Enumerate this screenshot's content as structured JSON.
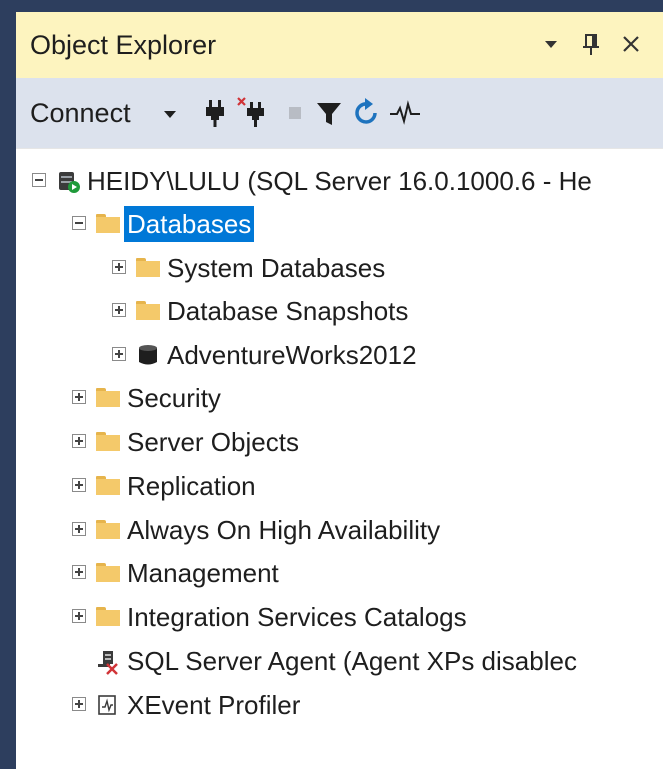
{
  "panel": {
    "title": "Object Explorer",
    "buttons": {
      "dropdown": "▾",
      "pin": "Ŧ",
      "close": "✕"
    }
  },
  "toolbar": {
    "connect_label": "Connect",
    "icons": [
      "connect-plug-icon",
      "disconnect-icon",
      "stop-icon",
      "filter-icon",
      "refresh-icon",
      "activity-monitor-icon"
    ]
  },
  "tree": {
    "server": "HEIDY\\LULU (SQL Server 16.0.1000.6 - He",
    "databases": "Databases",
    "db_children": [
      "System Databases",
      "Database Snapshots",
      "AdventureWorks2012"
    ],
    "nodes": [
      "Security",
      "Server Objects",
      "Replication",
      "Always On High Availability",
      "Management",
      "Integration Services Catalogs"
    ],
    "agent": "SQL Server Agent (Agent XPs disablec",
    "xevent": "XEvent Profiler"
  },
  "colors": {
    "title_bg": "#fdf4bf",
    "toolbar_bg": "#dce2ed",
    "selection": "#0078d7",
    "folder": "#f4c96a",
    "frame": "#2d3e5e"
  }
}
